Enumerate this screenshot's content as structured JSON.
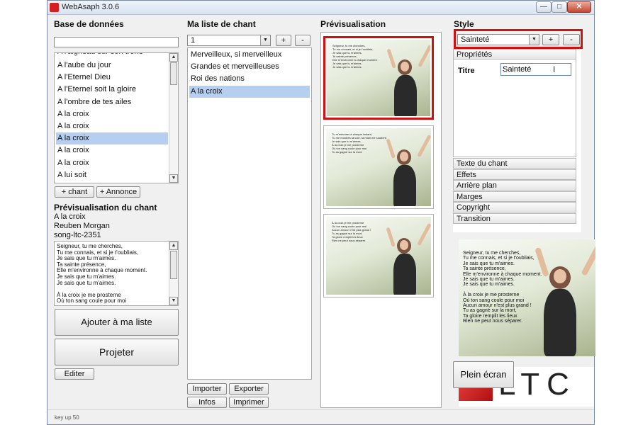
{
  "window": {
    "title": "WebAsaph 3.0.6"
  },
  "database": {
    "title": "Base de données",
    "search_value": "",
    "items": [
      {
        "label": "A l'aube du jour",
        "selected": false
      },
      {
        "label": "A l'Eternel Dieu",
        "selected": false
      },
      {
        "label": "A l'Eternel soit la gloire",
        "selected": false
      },
      {
        "label": "A l'ombre de tes ailes",
        "selected": false
      },
      {
        "label": "A la croix",
        "selected": false
      },
      {
        "label": "A la croix",
        "selected": false
      },
      {
        "label": "A la croix",
        "selected": true
      },
      {
        "label": "A la croix",
        "selected": false
      },
      {
        "label": "A la croix",
        "selected": false
      },
      {
        "label": "A lui soit",
        "selected": false
      }
    ],
    "add_song_label": "+ chant",
    "add_announce_label": "+ Annonce"
  },
  "preview_song": {
    "title": "Prévisualisation du chant",
    "name": "A la croix",
    "author": "Reuben Morgan",
    "ref": "song-ltc-2351",
    "lyrics": "Seigneur, tu me cherches,\nTu me connais, et si je t'oubliais,\nJe sais que tu m'aimes.\nTa sainte présence,\nElle m'environne à chaque moment.\nJe sais que tu m'aimes.\nJe sais que tu m'aimes.\n\nÀ la croix je me prosterne\nOù ton sang coule pour moi"
  },
  "actions": {
    "add_to_list": "Ajouter à ma liste",
    "project": "Projeter",
    "edit": "Editer"
  },
  "my_list": {
    "title": "Ma liste de chant",
    "selected_list": "1",
    "plus": "+",
    "minus": "-",
    "items": [
      {
        "label": "Merveilleux, si merveilleux",
        "selected": false
      },
      {
        "label": "Grandes et merveilleuses",
        "selected": false
      },
      {
        "label": "Roi des nations",
        "selected": false
      },
      {
        "label": "A la croix",
        "selected": true
      }
    ],
    "import_label": "Importer",
    "export_label": "Exporter",
    "info_label": "Infos",
    "print_label": "Imprimer"
  },
  "preview": {
    "title": "Prévisualisation",
    "slides": [
      "Seigneur, tu me cherches,\nTu me connais, et si je t'oubliais,\nJe sais que tu m'aimes.\nTa sainte présence,\nElle m'environne à chaque moment.\nJe sais que tu m'aimes.\nJe sais que tu m'aimes.",
      "Tu m'entoures à chaque instant,\nTu me montres ta voie, ta main me soutient.\nJe sais que tu m'aimes.\nÀ la croix je me prosterne\nOù ton sang coule pour moi\nTu as gagné sur la mort.",
      "À la croix je me prosterne\nOù ton sang coule pour moi\nAucun amour n'est plus grand !\nTu as gagné sur la mort,\nTa gloire remplit les lieux\nRien ne peut nous séparer."
    ]
  },
  "style": {
    "title": "Style",
    "selected": "Sainteté",
    "plus": "+",
    "minus": "-",
    "properties_label": "Propriétés",
    "field_label": "Titre",
    "field_value": "Sainteté",
    "sections": [
      "Texte du chant",
      "Effets",
      "Arrière plan",
      "Marges",
      "Copyright",
      "Transition"
    ],
    "preview_text": "Seigneur, tu me cherches,\nTu me connais, et si je t'oubliais,\nJe sais que tu m'aimes.\nTa sainte présence,\nElle m'environne à chaque moment.\nJe sais que tu m'aimes.\nJe sais que tu m'aimes.\n\nÀ la croix je me prosterne\nOù ton sang coule pour moi\nAucun amour n'est plus grand !\nTu as gagné sur la mort,\nTa gloire remplit les lieux\nRien ne peut nous séparer."
  },
  "fullscreen_label": "Plein écran",
  "logo_text": "LTC",
  "status_text": "key up 50",
  "colors": {
    "selection": "#b6cef0",
    "highlight_red": "#d11010",
    "window_bg": "#f0f0f0"
  },
  "icons": [
    "app-icon",
    "minimize-icon",
    "maximize-icon",
    "close-icon",
    "dropdown-arrow-icon",
    "scroll-up-icon",
    "scroll-down-icon",
    "text-cursor-icon"
  ]
}
